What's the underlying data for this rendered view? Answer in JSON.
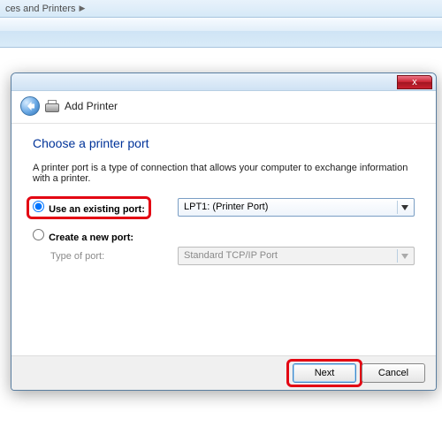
{
  "breadcrumb": {
    "segment": "ces and Printers"
  },
  "dialog": {
    "title": "Add Printer",
    "close_label": "x",
    "heading": "Choose a printer port",
    "description": "A printer port is a type of connection that allows your computer to exchange information with a printer.",
    "option_existing": {
      "label": "Use an existing port:",
      "value": "LPT1: (Printer Port)"
    },
    "option_new": {
      "label": "Create a new port:",
      "sublabel": "Type of port:",
      "value": "Standard TCP/IP Port"
    },
    "buttons": {
      "next": "Next",
      "cancel": "Cancel"
    }
  }
}
